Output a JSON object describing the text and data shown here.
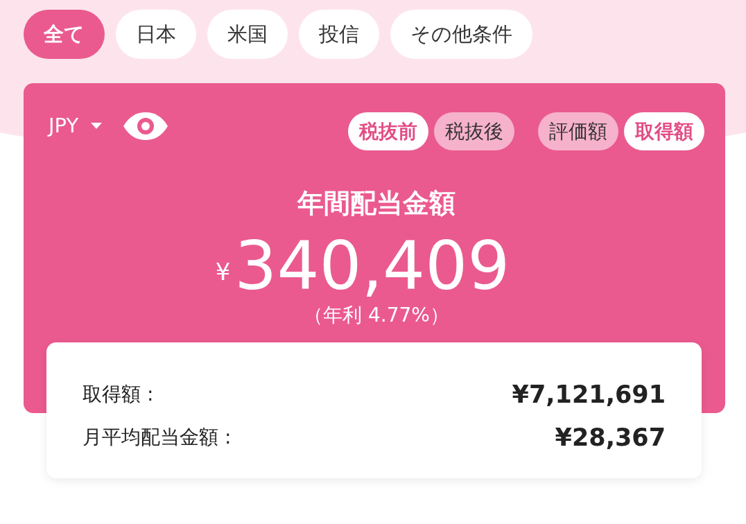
{
  "filters": [
    {
      "label": "全て",
      "selected": true
    },
    {
      "label": "日本",
      "selected": false
    },
    {
      "label": "米国",
      "selected": false
    },
    {
      "label": "投信",
      "selected": false
    },
    {
      "label": "その他条件",
      "selected": false
    }
  ],
  "currency": {
    "label": "JPY"
  },
  "tax_toggle": [
    {
      "label": "税抜前",
      "selected": true
    },
    {
      "label": "税抜後",
      "selected": false
    }
  ],
  "basis_toggle": [
    {
      "label": "評価額",
      "selected": false
    },
    {
      "label": "取得額",
      "selected": true
    }
  ],
  "summary": {
    "title": "年間配当金額",
    "currency_symbol": "¥",
    "amount": "340,409",
    "yield": "（年利 4.77%）"
  },
  "details": [
    {
      "label": "取得額 :",
      "value": "¥7,121,691"
    },
    {
      "label": "月平均配当金額 :",
      "value": "¥28,367"
    }
  ]
}
